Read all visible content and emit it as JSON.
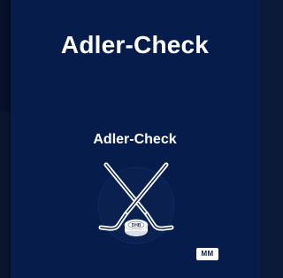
{
  "app": {
    "title": "Adler-Check"
  },
  "logo": {
    "title": "Adler-Check",
    "icon": "hockey-sticks-puck-icon",
    "puck_text": "DHB"
  },
  "badge": {
    "label": "MM"
  },
  "colors": {
    "background": "#061c4b",
    "text": "#ffffff",
    "circle": "#0a2150",
    "puck": "#ffffff"
  }
}
